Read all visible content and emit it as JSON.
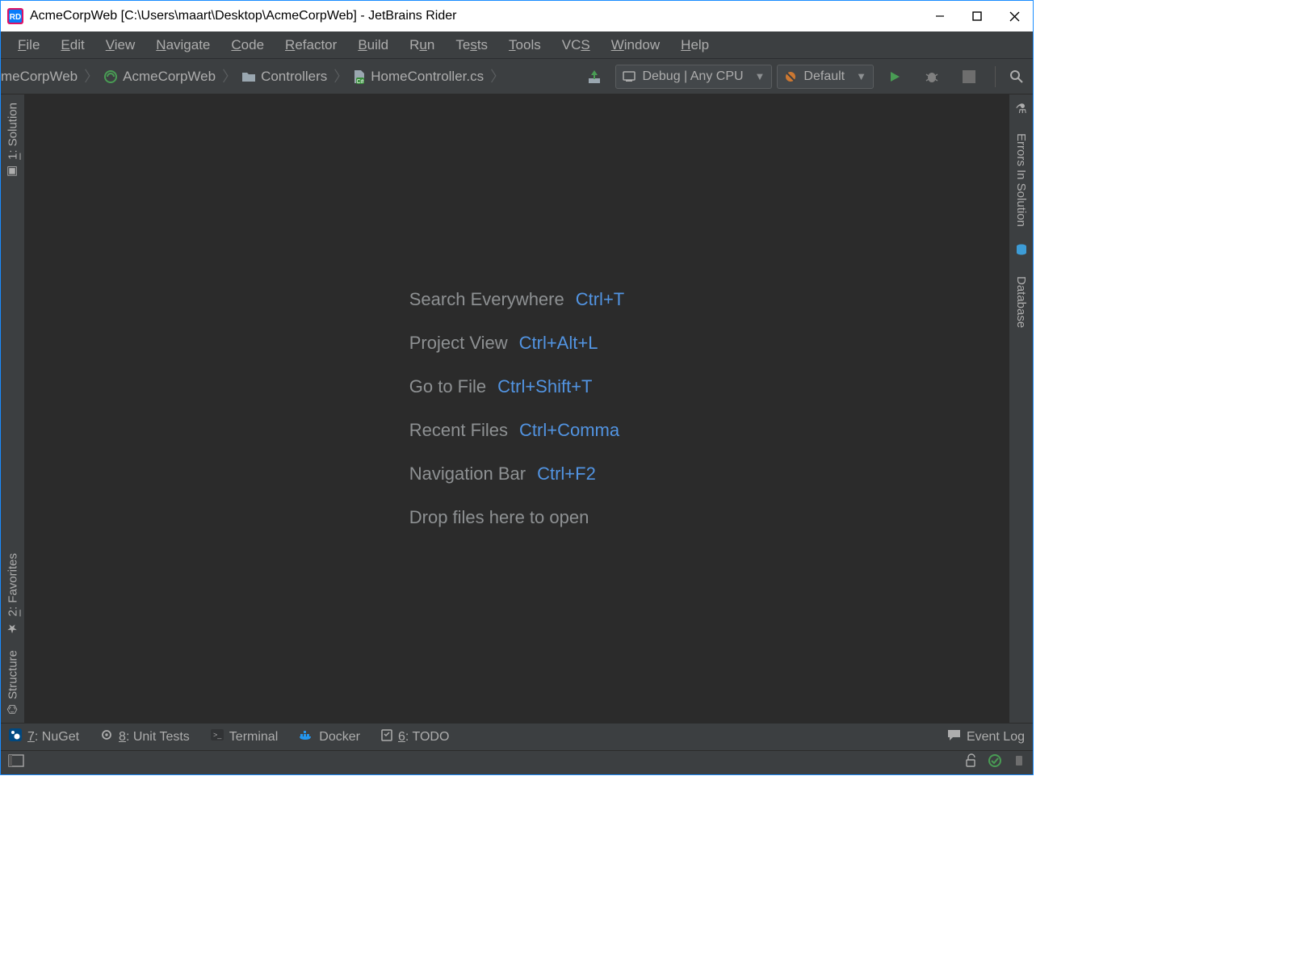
{
  "title": "AcmeCorpWeb [C:\\Users\\maart\\Desktop\\AcmeCorpWeb] - JetBrains Rider",
  "menu": {
    "file": "File",
    "edit": "Edit",
    "view": "View",
    "navigate": "Navigate",
    "code": "Code",
    "refactor": "Refactor",
    "build": "Build",
    "run": "Run",
    "tests": "Tests",
    "tools": "Tools",
    "vcs": "VCS",
    "window": "Window",
    "help": "Help"
  },
  "breadcrumbs": {
    "b0": "meCorpWeb",
    "b1": "AcmeCorpWeb",
    "b2": "Controllers",
    "b3": "HomeController.cs"
  },
  "toolbar": {
    "config": "Debug | Any CPU",
    "target": "Default"
  },
  "left_tools": {
    "solution": "1: Solution",
    "favorites": "2: Favorites",
    "structure": "Structure"
  },
  "right_tools": {
    "errors": "Errors In Solution",
    "database": "Database"
  },
  "hints": {
    "h0_label": "Search Everywhere",
    "h0_key": "Ctrl+T",
    "h1_label": "Project View",
    "h1_key": "Ctrl+Alt+L",
    "h2_label": "Go to File",
    "h2_key": "Ctrl+Shift+T",
    "h3_label": "Recent Files",
    "h3_key": "Ctrl+Comma",
    "h4_label": "Navigation Bar",
    "h4_key": "Ctrl+F2",
    "drop": "Drop files here to open"
  },
  "status": {
    "nuget": "7: NuGet",
    "unit_tests": "8: Unit Tests",
    "terminal": "Terminal",
    "docker": "Docker",
    "todo": "6: TODO",
    "event_log": "Event Log"
  }
}
